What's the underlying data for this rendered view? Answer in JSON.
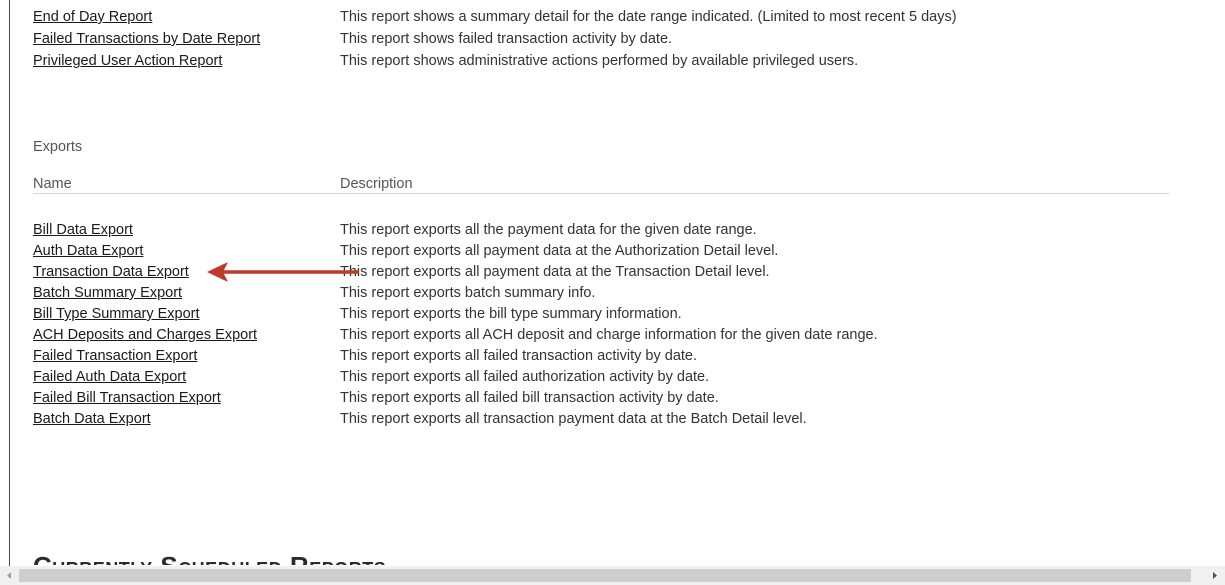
{
  "reports_top": [
    {
      "name": "End of Day Report",
      "description": "This report shows a summary detail for the date range indicated. (Limited to most recent 5 days)"
    },
    {
      "name": "Failed Transactions by Date Report",
      "description": "This report shows failed transaction activity by date."
    },
    {
      "name": "Privileged User Action Report",
      "description": "This report shows administrative actions performed by available privileged users."
    }
  ],
  "exports": {
    "section_title": "Exports",
    "col_name": "Name",
    "col_description": "Description",
    "items": [
      {
        "name": "Bill Data Export",
        "description": "This report exports all the payment data for the given date range."
      },
      {
        "name": "Auth Data Export",
        "description": "This report exports all payment data at the Authorization Detail level."
      },
      {
        "name": "Transaction Data Export",
        "description": "This report exports all payment data at the Transaction Detail level."
      },
      {
        "name": "Batch Summary Export",
        "description": "This report exports batch summary info."
      },
      {
        "name": "Bill Type Summary Export",
        "description": "This report exports the bill type summary information."
      },
      {
        "name": "ACH Deposits and Charges Export",
        "description": "This report exports all ACH deposit and charge information for the given date range."
      },
      {
        "name": "Failed Transaction Export",
        "description": "This report exports all failed transaction activity by date."
      },
      {
        "name": "Failed Auth Data Export",
        "description": "This report exports all failed authorization activity by date."
      },
      {
        "name": "Failed Bill Transaction Export",
        "description": "This report exports all failed bill transaction activity by date."
      },
      {
        "name": "Batch Data Export",
        "description": "This report exports all transaction payment data at the Batch Detail level."
      }
    ]
  },
  "scheduled": {
    "heading": "Currently Scheduled Reports"
  },
  "annotation": {
    "arrow_color": "#c0392b",
    "points_to": "Transaction Data Export"
  },
  "icons": {
    "scroll_left": "chevron-left-icon",
    "scroll_right": "chevron-right-icon"
  }
}
